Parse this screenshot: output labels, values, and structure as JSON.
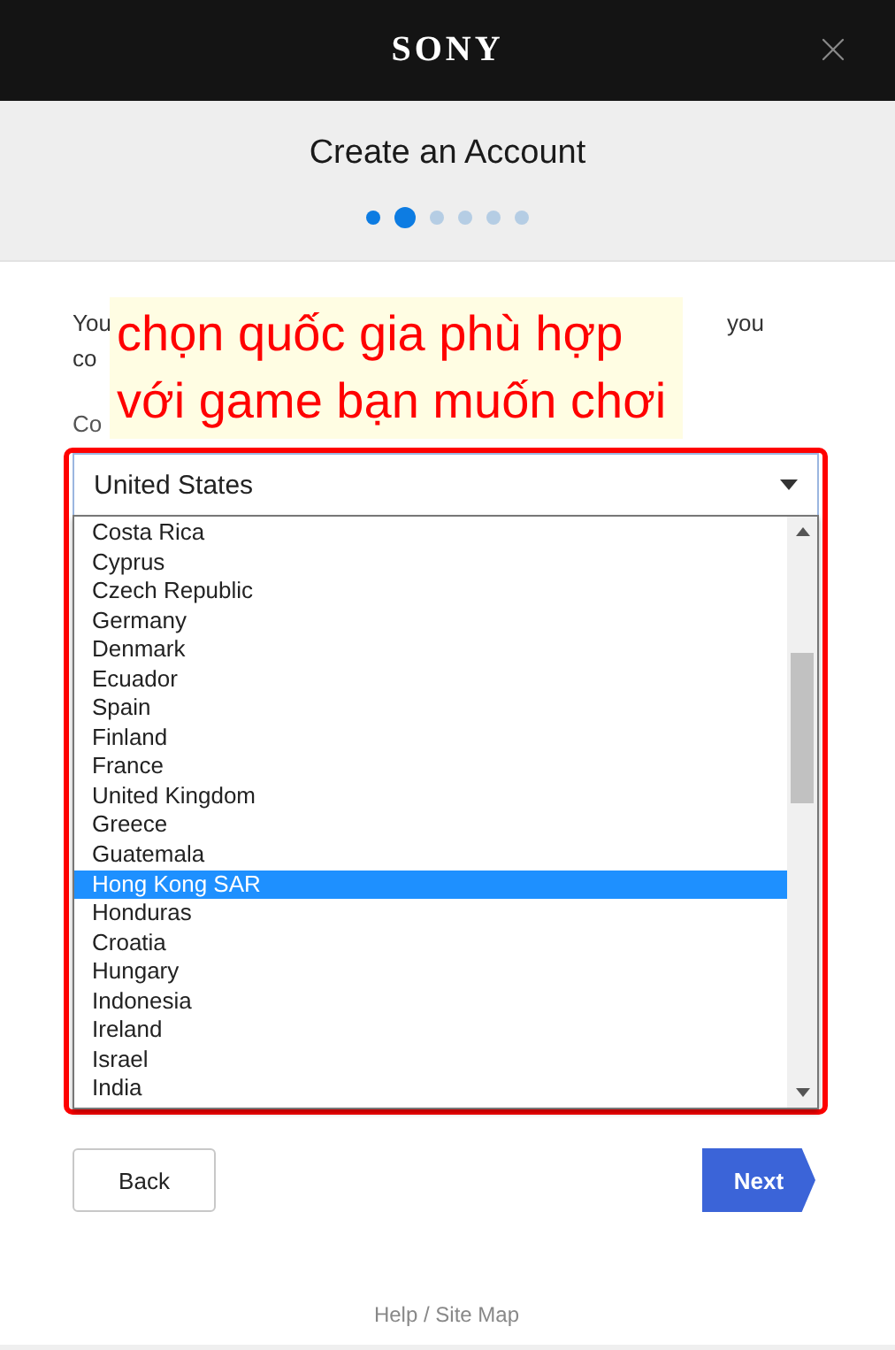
{
  "header": {
    "logo": "SONY"
  },
  "title": "Create an Account",
  "steps": [
    {
      "selected": false
    },
    {
      "selected": true
    },
    {
      "selected": false
    },
    {
      "selected": false
    },
    {
      "selected": false
    },
    {
      "selected": false
    }
  ],
  "description": {
    "line_1_start": "You",
    "line_1_end": "you",
    "line_2_start": "co"
  },
  "annotation": {
    "lines": [
      "chọn quốc gia phù hợp",
      "với game bạn muốn chơi"
    ]
  },
  "country_field": {
    "label": "Co",
    "value": "United States",
    "expanded": true,
    "options": [
      {
        "label": "Costa Rica",
        "selected": false
      },
      {
        "label": "Cyprus",
        "selected": false
      },
      {
        "label": "Czech Republic",
        "selected": false
      },
      {
        "label": "Germany",
        "selected": false
      },
      {
        "label": "Denmark",
        "selected": false
      },
      {
        "label": "Ecuador",
        "selected": false
      },
      {
        "label": "Spain",
        "selected": false
      },
      {
        "label": "Finland",
        "selected": false
      },
      {
        "label": "France",
        "selected": false
      },
      {
        "label": "United Kingdom",
        "selected": false
      },
      {
        "label": "Greece",
        "selected": false
      },
      {
        "label": "Guatemala",
        "selected": false
      },
      {
        "label": "Hong Kong SAR",
        "selected": true
      },
      {
        "label": "Honduras",
        "selected": false
      },
      {
        "label": "Croatia",
        "selected": false
      },
      {
        "label": "Hungary",
        "selected": false
      },
      {
        "label": "Indonesia",
        "selected": false
      },
      {
        "label": "Ireland",
        "selected": false
      },
      {
        "label": "Israel",
        "selected": false
      },
      {
        "label": "India",
        "selected": false
      }
    ]
  },
  "buttons": [
    {
      "label": "Back",
      "kind": "secondary"
    },
    {
      "label": "Next",
      "kind": "primary"
    }
  ],
  "footer": {
    "link": "Help / Site Map"
  }
}
